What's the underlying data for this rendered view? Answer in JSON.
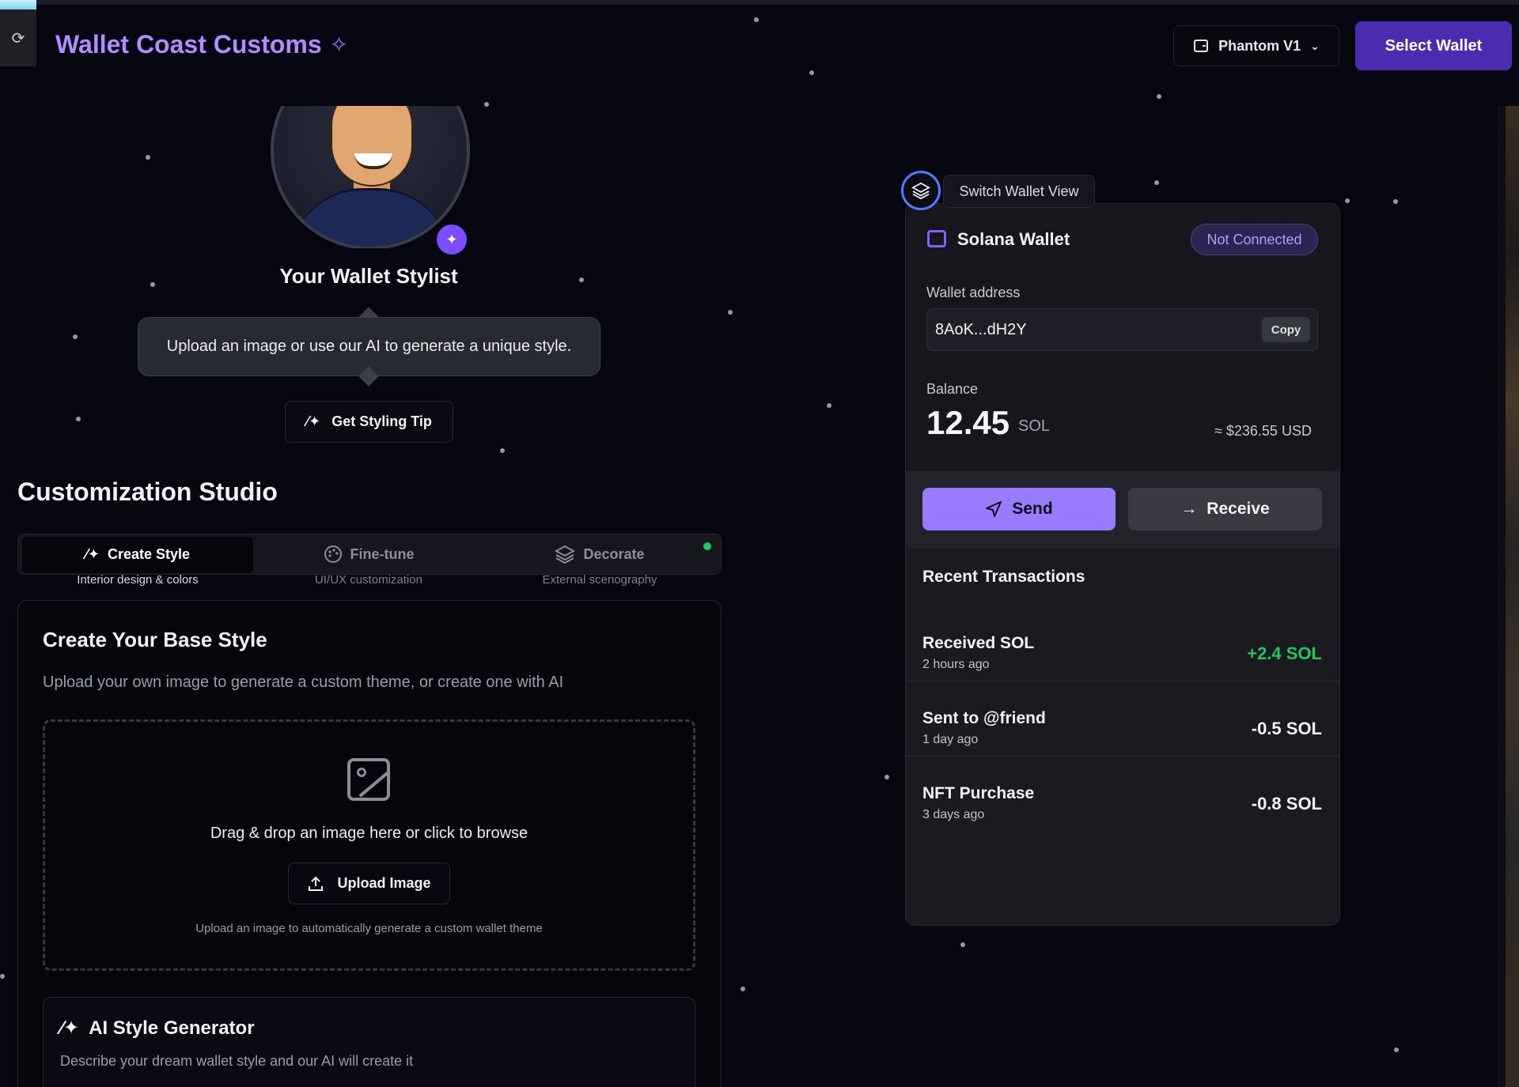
{
  "header": {
    "app_title": "Wallet Coast Customs",
    "network_label": "Phantom V1",
    "select_wallet_label": "Select Wallet"
  },
  "stylist": {
    "title": "Your Wallet Stylist",
    "message": "Upload an image or use our AI to generate a unique style.",
    "tip_button": "Get Styling Tip"
  },
  "studio": {
    "title": "Customization Studio",
    "tabs": [
      {
        "label": "Create Style",
        "subtitle": "Interior design & colors",
        "icon": "magic-wand-icon",
        "active": true
      },
      {
        "label": "Fine-tune",
        "subtitle": "UI/UX customization",
        "icon": "palette-icon",
        "active": false
      },
      {
        "label": "Decorate",
        "subtitle": "External scenography",
        "icon": "layers-icon",
        "active": false
      }
    ],
    "base_style": {
      "title": "Create Your Base Style",
      "subtitle": "Upload your own image to generate a custom theme, or create one with AI",
      "dropzone_text": "Drag & drop an image here or click to browse",
      "upload_button": "Upload Image",
      "upload_hint": "Upload an image to automatically generate a custom wallet theme"
    },
    "ai_generator": {
      "title": "AI Style Generator",
      "subtitle": "Describe your dream wallet style and our AI will create it"
    }
  },
  "wallet": {
    "switch_view_label": "Switch Wallet View",
    "name": "Solana Wallet",
    "status": "Not Connected",
    "address_label": "Wallet address",
    "address": "8AoK...dH2Y",
    "copy_label": "Copy",
    "balance_label": "Balance",
    "balance": "12.45",
    "balance_unit": "SOL",
    "balance_usd": "≈ $236.55 USD",
    "send_label": "Send",
    "receive_label": "Receive",
    "transactions_title": "Recent Transactions",
    "transactions": [
      {
        "title": "Received SOL",
        "time": "2 hours ago",
        "amount": "+2.4 SOL"
      },
      {
        "title": "Sent to @friend",
        "time": "1 day ago",
        "amount": "-0.5 SOL"
      },
      {
        "title": "NFT Purchase",
        "time": "3 days ago",
        "amount": "-0.8 SOL"
      }
    ]
  },
  "colors": {
    "accent": "#9a7bff",
    "brand_button": "#4b2bb0",
    "positive": "#22c55e",
    "negative": "#f2f2f5"
  }
}
